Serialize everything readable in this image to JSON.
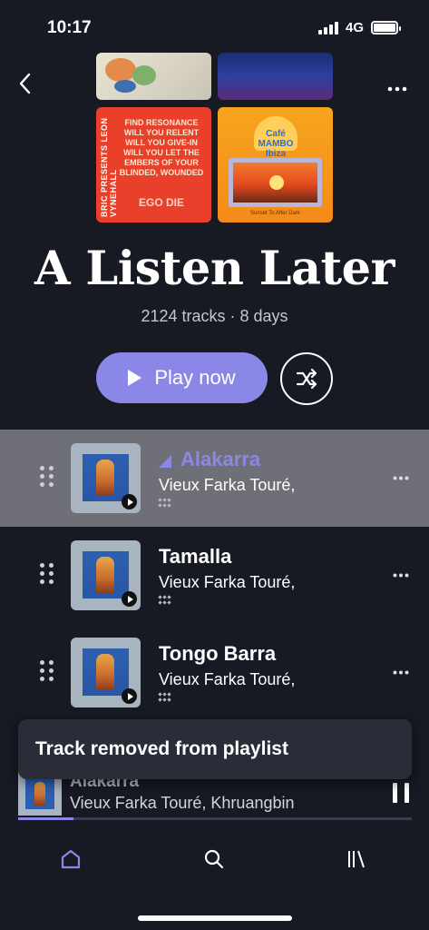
{
  "status_bar": {
    "time": "10:17",
    "network": "4G"
  },
  "playlist": {
    "title": "A Listen Later",
    "meta": "2124 tracks · 8 days"
  },
  "covers": [
    {
      "icon": "abstract-art"
    },
    {
      "icon": "blue-wave-art"
    },
    {
      "side_text": "BRIC PRESENTS LEON VYNEHALL",
      "text": "FIND RESONANCE WILL YOU RELENT WILL YOU GIVE-IN WILL YOU LET THE EMBERS OF YOUR BLINDED, WOUNDED",
      "emphasis": "EGO DIE"
    },
    {
      "logo_text": "Café MAMBO Ibiza",
      "subtitle": "Sunset To After Dark"
    }
  ],
  "actions": {
    "play_label": "Play now",
    "shuffle_icon": "shuffle-icon"
  },
  "tracks": [
    {
      "title": "Alakarra",
      "artist": "Vieux Farka Touré,",
      "state": "playing"
    },
    {
      "title": "Tamalla",
      "artist": "Vieux Farka Touré,",
      "state": "idle"
    },
    {
      "title": "Tongo Barra",
      "artist": "Vieux Farka Touré,",
      "state": "idle"
    }
  ],
  "toast": {
    "message": "Track removed from playlist"
  },
  "now_playing": {
    "title": "Alakarra",
    "artist": "Vieux Farka Touré, Khruangbin",
    "progress": 0.14
  },
  "colors": {
    "accent": "#8b87e6",
    "background": "#171923",
    "active_row": "#6f7077"
  },
  "tabs": [
    {
      "name": "home",
      "icon": "home-icon",
      "active": true
    },
    {
      "name": "search",
      "icon": "search-icon",
      "active": false
    },
    {
      "name": "library",
      "icon": "library-icon",
      "active": false
    }
  ]
}
